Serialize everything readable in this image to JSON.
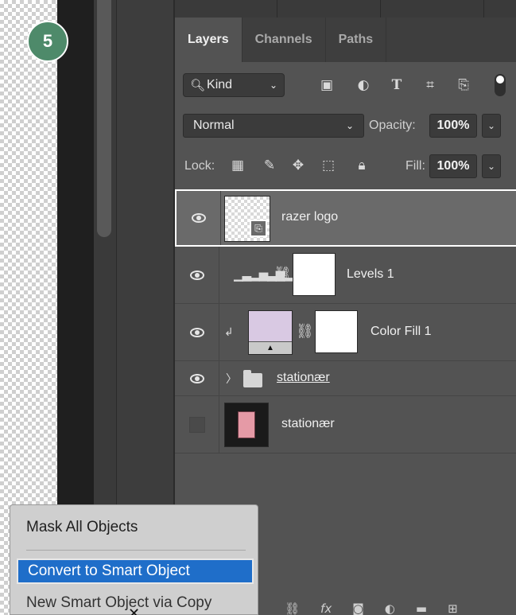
{
  "step_badge": "5",
  "tabs": [
    {
      "label": "Layers",
      "active": true
    },
    {
      "label": "Channels",
      "active": false
    },
    {
      "label": "Paths",
      "active": false
    }
  ],
  "filter": {
    "kind_label": "Kind",
    "icons": [
      "image-filter-icon",
      "adjustment-filter-icon",
      "type-filter-icon",
      "shape-filter-icon",
      "smart-object-filter-icon",
      "filter-toggle-icon"
    ]
  },
  "blend": {
    "mode": "Normal",
    "opacity_label": "Opacity:",
    "opacity_value": "100%"
  },
  "lock": {
    "label": "Lock:",
    "fill_label": "Fill:",
    "fill_value": "100%"
  },
  "layers": [
    {
      "name": "razer logo",
      "visible": true,
      "selected": true,
      "kind": "smart-object"
    },
    {
      "name": "Levels 1",
      "visible": true,
      "selected": false,
      "kind": "adjustment-levels"
    },
    {
      "name": "Color Fill 1",
      "visible": true,
      "selected": false,
      "kind": "color-fill",
      "fill_color": "#d9c9e3"
    },
    {
      "name": "stationær",
      "visible": true,
      "selected": false,
      "kind": "group"
    },
    {
      "name": "stationær",
      "visible": false,
      "selected": false,
      "kind": "pixel"
    }
  ],
  "context_menu": {
    "items": [
      {
        "label": "Mask All Objects",
        "highlighted": false
      },
      {
        "label": "Convert to Smart Object",
        "highlighted": true
      },
      {
        "label": "New Smart Object via Copy",
        "highlighted": false
      }
    ]
  },
  "bottom_bar": {
    "icons": [
      "close-icon",
      "link-layers-icon",
      "fx-icon",
      "add-mask-icon",
      "new-adjustment-icon",
      "new-group-icon",
      "new-layer-icon"
    ],
    "close_glyph": "✕"
  },
  "colors": {
    "panel_bg": "#535353",
    "selected_bg": "#6a6a6a",
    "highlight": "#1f6ec9",
    "badge": "#4e8a6a"
  }
}
